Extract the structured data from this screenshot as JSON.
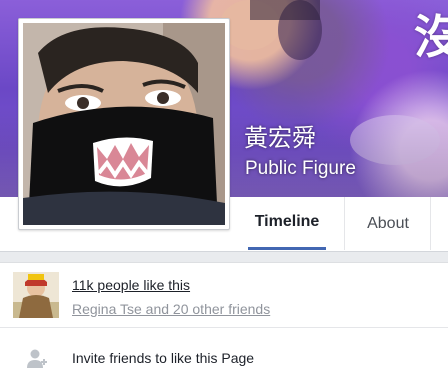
{
  "cover": {
    "overlay_glyph": "沒"
  },
  "page": {
    "name": "黃宏舜",
    "category": "Public Figure"
  },
  "tabs": [
    {
      "label": "Timeline",
      "active": true
    },
    {
      "label": "About",
      "active": false
    }
  ],
  "likes": {
    "count_text": "11k people like this",
    "friends_text": "Regina Tse and 20 other friends"
  },
  "invite": {
    "label": "Invite friends to like this Page",
    "icon": "add-friend-icon"
  },
  "colors": {
    "accent": "#4267b2",
    "muted_text": "#90949c",
    "background": "#e9ebee"
  }
}
